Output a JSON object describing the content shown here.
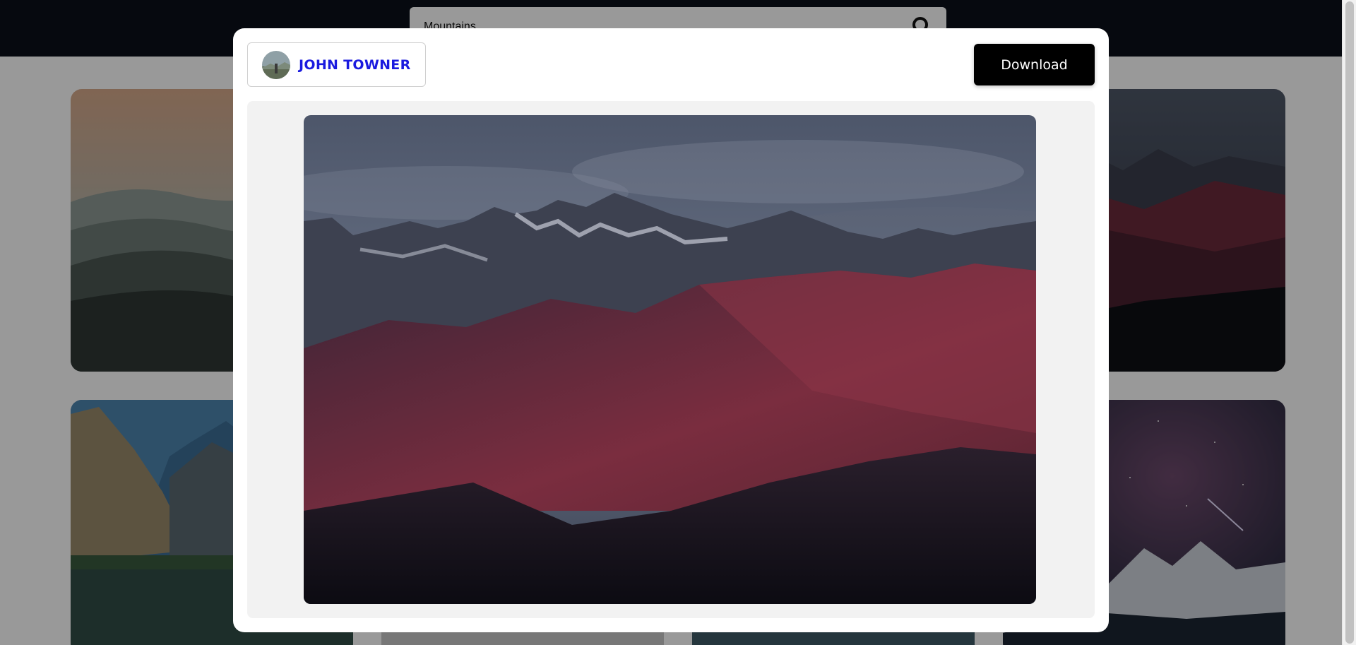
{
  "search": {
    "value": "Mountains",
    "button_icon": "search-icon"
  },
  "modal": {
    "author": {
      "name": "JOHN TOWNER",
      "avatar_icon": "avatar-photo"
    },
    "download_label": "Download",
    "image_description_icon": "mountain-photo"
  },
  "colors": {
    "header_bg": "#0b0f1a",
    "author_name": "#1a1adf",
    "download_bg": "#000000",
    "image_area_bg": "#f2f2f2"
  }
}
